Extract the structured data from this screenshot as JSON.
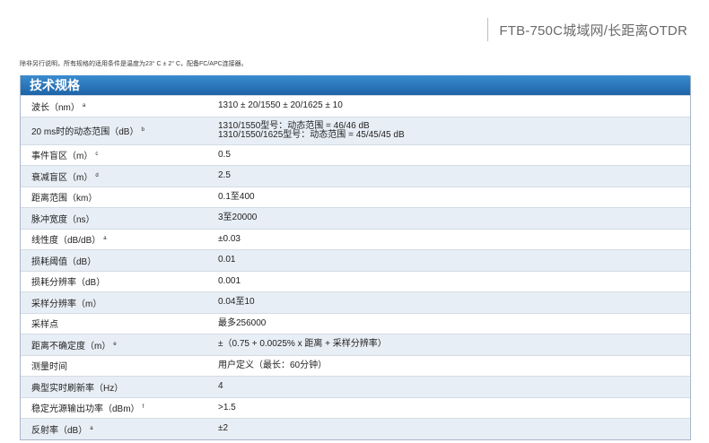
{
  "header": {
    "title": "FTB-750C城域网/长距离OTDR"
  },
  "note": "除非另行说明，所有规格的适用条件是温度为23° C ± 2° C，配备FC/APC连接器。",
  "table": {
    "title": "技术规格",
    "rows": [
      {
        "label": "波长（nm）",
        "sup": "a",
        "value": "1310 ± 20/1550 ± 20/1625 ± 10",
        "value2": ""
      },
      {
        "label": "20 ms时的动态范围（dB）",
        "sup": "b",
        "value": "1310/1550型号：动态范围 = 46/46 dB",
        "value2": "1310/1550/1625型号：动态范围 = 45/45/45 dB"
      },
      {
        "label": "事件盲区（m）",
        "sup": "c",
        "value": "0.5",
        "value2": ""
      },
      {
        "label": "衰减盲区（m）",
        "sup": "d",
        "value": "2.5",
        "value2": ""
      },
      {
        "label": "距离范围（km）",
        "sup": "",
        "value": "0.1至400",
        "value2": ""
      },
      {
        "label": "脉冲宽度（ns）",
        "sup": "",
        "value": "3至20000",
        "value2": ""
      },
      {
        "label": "线性度（dB/dB）",
        "sup": "a",
        "value": "±0.03",
        "value2": ""
      },
      {
        "label": "损耗阈值（dB）",
        "sup": "",
        "value": "0.01",
        "value2": ""
      },
      {
        "label": "损耗分辨率（dB）",
        "sup": "",
        "value": "0.001",
        "value2": ""
      },
      {
        "label": "采样分辨率（m）",
        "sup": "",
        "value": "0.04至10",
        "value2": ""
      },
      {
        "label": "采样点",
        "sup": "",
        "value": "最多256000",
        "value2": ""
      },
      {
        "label": "距离不确定度（m）",
        "sup": "e",
        "value": "±（0.75 + 0.0025% x 距离 + 采样分辨率）",
        "value2": ""
      },
      {
        "label": "测量时间",
        "sup": "",
        "value": "用户定义（最长：60分钟）",
        "value2": ""
      },
      {
        "label": "典型实时刷新率（Hz）",
        "sup": "",
        "value": "4",
        "value2": ""
      },
      {
        "label": "稳定光源输出功率（dBm）",
        "sup": "f",
        "value": ">1.5",
        "value2": ""
      },
      {
        "label": "反射率（dB）",
        "sup": "a",
        "value": "±2",
        "value2": ""
      }
    ]
  },
  "colors": {
    "title_bar": "#2b78be",
    "row_alt": "#e8eef5",
    "border": "#a8b7c9"
  }
}
